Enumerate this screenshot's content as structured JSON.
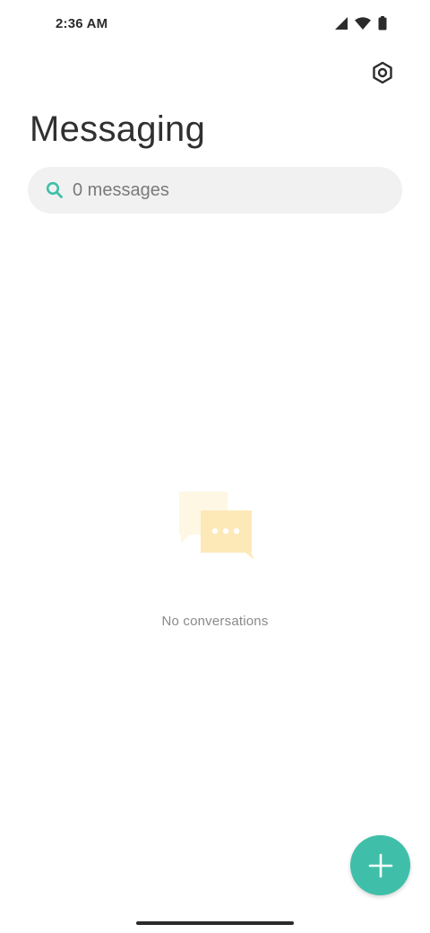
{
  "status_bar": {
    "time": "2:36 AM",
    "icons": [
      "cellular-signal-icon",
      "wifi-icon",
      "battery-icon"
    ]
  },
  "header": {
    "title": "Messaging",
    "settings_icon": "gear-icon"
  },
  "search": {
    "placeholder": "0 messages",
    "value": ""
  },
  "empty_state": {
    "icon": "chat-bubbles-icon",
    "text": "No conversations"
  },
  "fab": {
    "icon": "plus-icon"
  },
  "colors": {
    "accent": "#3fbfa9",
    "search_bg": "#f1f1f1",
    "illustration_front": "#fde9b8",
    "illustration_back": "#fef7e4"
  }
}
